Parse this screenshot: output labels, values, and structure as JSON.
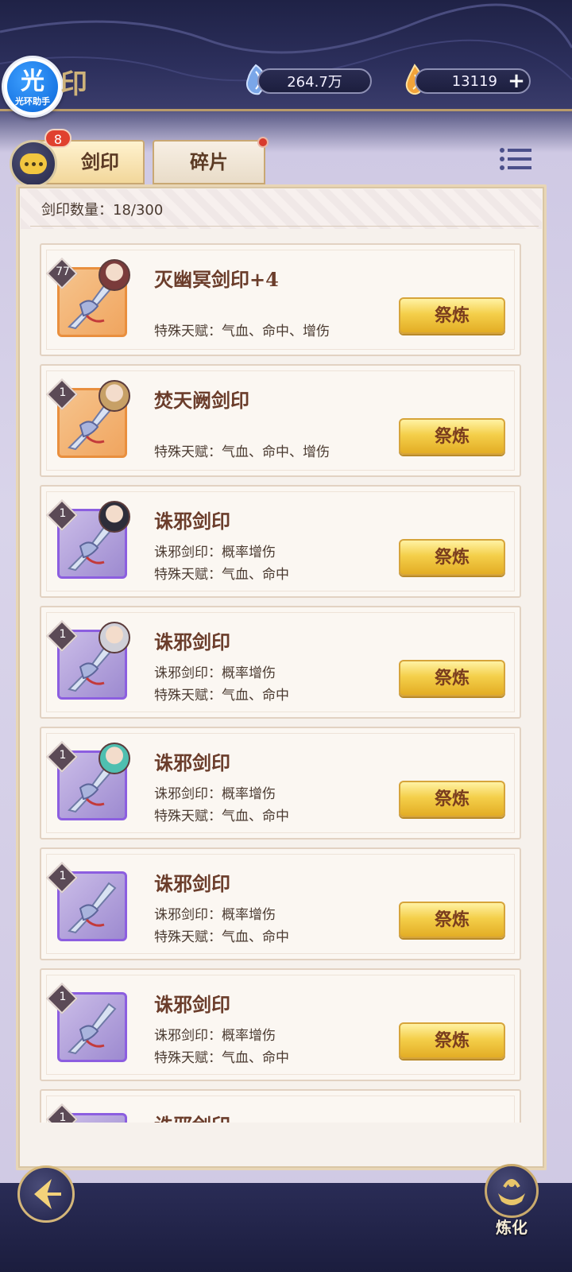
{
  "header": {
    "app_badge_glyph": "光",
    "app_badge_label": "光环助手",
    "title_fragment": "印",
    "currency_jade": "264.7万",
    "currency_gold": "13119",
    "plus_label": "+"
  },
  "tabs": {
    "chat_badge": "8",
    "active_label": "剑印",
    "inactive_label": "碎片"
  },
  "panel": {
    "count_label": "剑印数量：18/300"
  },
  "colors": {
    "accent_gold": "#f4cf4a",
    "frame_orange": "#e98f3e",
    "frame_purple": "#8c5ee0",
    "badge_red": "#e0412f"
  },
  "items": [
    {
      "level": "77",
      "name": "灭幽冥剑印+4",
      "line1": "",
      "line2": "特殊天赋：气血、命中、增伤",
      "button": "祭炼",
      "frame": "orange",
      "icon": "sword-seal-icon"
    },
    {
      "level": "1",
      "name": "焚天阙剑印",
      "line1": "",
      "line2": "特殊天赋：气血、命中、增伤",
      "button": "祭炼",
      "frame": "orange",
      "icon": "sword-seal-icon"
    },
    {
      "level": "1",
      "name": "诛邪剑印",
      "line1": "诛邪剑印：概率增伤",
      "line2": "特殊天赋：气血、命中",
      "button": "祭炼",
      "frame": "purple",
      "icon": "sword-seal-icon"
    },
    {
      "level": "1",
      "name": "诛邪剑印",
      "line1": "诛邪剑印：概率增伤",
      "line2": "特殊天赋：气血、命中",
      "button": "祭炼",
      "frame": "purple",
      "icon": "sword-seal-icon"
    },
    {
      "level": "1",
      "name": "诛邪剑印",
      "line1": "诛邪剑印：概率增伤",
      "line2": "特殊天赋：气血、命中",
      "button": "祭炼",
      "frame": "purple",
      "icon": "sword-seal-icon"
    },
    {
      "level": "1",
      "name": "诛邪剑印",
      "line1": "诛邪剑印：概率增伤",
      "line2": "特殊天赋：气血、命中",
      "button": "祭炼",
      "frame": "purple",
      "icon": "sword-seal-icon"
    },
    {
      "level": "1",
      "name": "诛邪剑印",
      "line1": "诛邪剑印：概率增伤",
      "line2": "特殊天赋：气血、命中",
      "button": "祭炼",
      "frame": "purple",
      "icon": "sword-seal-icon"
    },
    {
      "level": "1",
      "name": "诛邪剑印",
      "line1": "",
      "line2": "",
      "button": "",
      "frame": "purple",
      "icon": "sword-seal-icon"
    }
  ],
  "bottom": {
    "refine_nav_label": "炼化"
  }
}
